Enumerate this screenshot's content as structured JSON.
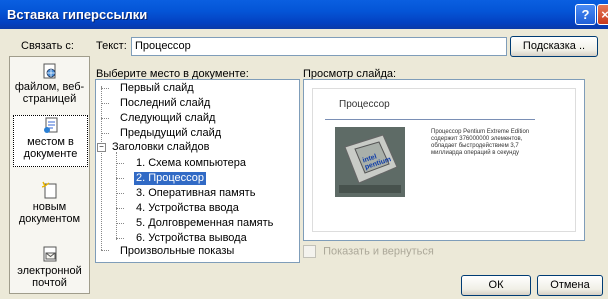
{
  "window": {
    "title": "Вставка гиперссылки"
  },
  "title_buttons": {
    "help": "?",
    "close": "×"
  },
  "link_to_label": "Связать с:",
  "text_label": "Текст:",
  "text_value": "Процессор",
  "tooltip_button": "Подсказка ..",
  "linkbar": [
    {
      "label": "файлом, веб-страницей",
      "icon": "globe-file-icon"
    },
    {
      "label": "местом в документе",
      "icon": "document-place-icon"
    },
    {
      "label": "новым документом",
      "icon": "new-document-icon"
    },
    {
      "label": "электронной почтой",
      "icon": "email-icon"
    }
  ],
  "tree_header": "Выберите место в документе:",
  "tree": {
    "first": "Первый слайд",
    "last": "Последний слайд",
    "next": "Следующий слайд",
    "prev": "Предыдущий слайд",
    "titles_group": "Заголовки слайдов",
    "titles": [
      "1. Схема компьютера",
      "2. Процессор",
      "3. Оперативная память",
      "4. Устройства ввода",
      "5. Долговременная память",
      "6. Устройства вывода"
    ],
    "custom_shows": "Произвольные показы",
    "expander": "−"
  },
  "preview_label": "Просмотр слайда:",
  "preview": {
    "slide_title": "Процессор",
    "chip_text": "intel pentium",
    "bullet": "Процессор Pentium Extreme Edition содержит 376000000 элементов, обладает быстродействием 3,7 миллиарда операций в секунду"
  },
  "show_and_return": "Показать и вернуться",
  "ok": "ОК",
  "cancel": "Отмена",
  "colors": {
    "title_bar": "#0454d6",
    "selection": "#316ac5",
    "dialog_bg": "#ece9d8"
  }
}
